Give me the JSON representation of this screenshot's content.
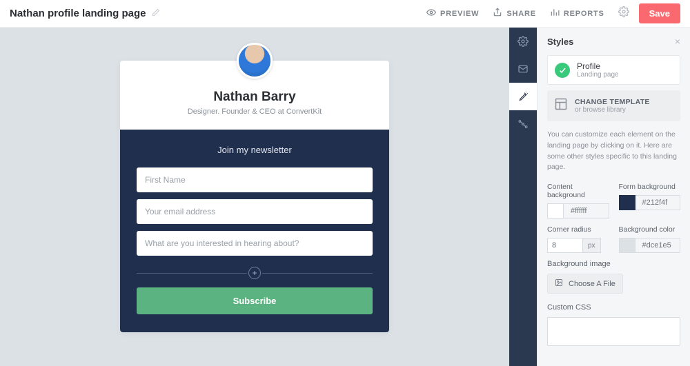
{
  "topbar": {
    "title": "Nathan profile landing page",
    "preview": "PREVIEW",
    "share": "SHARE",
    "reports": "REPORTS",
    "save": "Save"
  },
  "card": {
    "name": "Nathan Barry",
    "tagline": "Designer. Founder & CEO at ConvertKit",
    "lead": "Join my newsletter",
    "first_name_placeholder": "First Name",
    "email_placeholder": "Your email address",
    "interest_placeholder": "What are you interested in hearing about?",
    "subscribe": "Subscribe"
  },
  "panel": {
    "title": "Styles",
    "profile": {
      "title": "Profile",
      "sub": "Landing page"
    },
    "change_template": {
      "title": "CHANGE TEMPLATE",
      "sub": "or browse library"
    },
    "help": "You can customize each element on the landing page by clicking on it. Here are some other styles specific to this landing page.",
    "content_bg_label": "Content background",
    "form_bg_label": "Form background",
    "content_bg_value": "#ffffff",
    "form_bg_value": "#212f4f",
    "corner_radius_label": "Corner radius",
    "bg_color_label": "Background color",
    "corner_radius_value": "8",
    "corner_radius_unit": "px",
    "bg_color_value": "#dce1e5",
    "bg_image_label": "Background image",
    "choose_file": "Choose A File",
    "custom_css_label": "Custom CSS"
  },
  "colors": {
    "accent": "#fb6970",
    "navy": "#212f4f",
    "canvas": "#dce1e5",
    "success": "#5bb381"
  }
}
